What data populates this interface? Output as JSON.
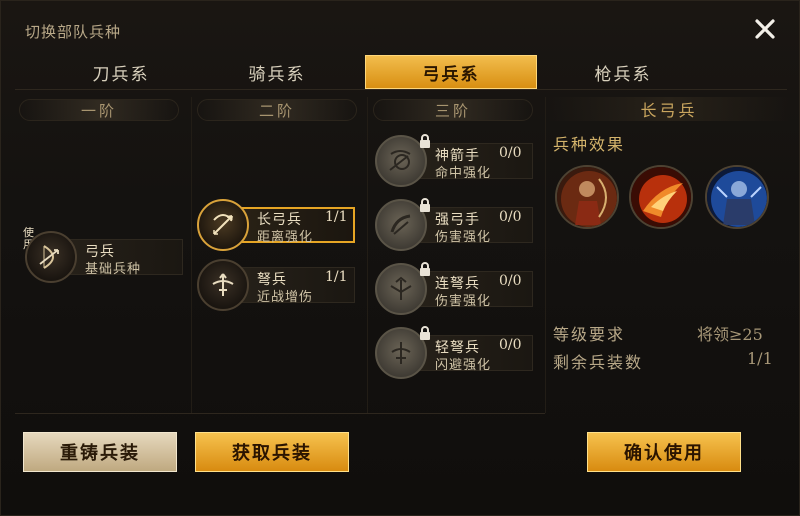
{
  "window": {
    "title": "切换部队兵种",
    "close_icon": "close-icon"
  },
  "tabs": [
    {
      "label": "刀兵系",
      "active": false
    },
    {
      "label": "骑兵系",
      "active": false
    },
    {
      "label": "弓兵系",
      "active": true
    },
    {
      "label": "枪兵系",
      "active": false
    }
  ],
  "tiers": [
    "一阶",
    "二阶",
    "三阶"
  ],
  "units": {
    "tier1": [
      {
        "name": "弓兵",
        "count": "",
        "desc": "基础兵种",
        "in_use": true,
        "use_label": "使用",
        "icon": "bow-icon"
      }
    ],
    "tier2": [
      {
        "name": "长弓兵",
        "count": "1/1",
        "desc": "距离强化",
        "selected": true,
        "icon": "longbow-icon"
      },
      {
        "name": "弩兵",
        "count": "1/1",
        "desc": "近战增伤",
        "icon": "crossbow-icon"
      }
    ],
    "tier3": [
      {
        "name": "神箭手",
        "count": "0/0",
        "desc": "命中强化",
        "locked": true,
        "icon": "target-bow-icon"
      },
      {
        "name": "强弓手",
        "count": "0/0",
        "desc": "伤害强化",
        "locked": true,
        "icon": "strong-bow-icon"
      },
      {
        "name": "连弩兵",
        "count": "0/0",
        "desc": "伤害强化",
        "locked": true,
        "icon": "repeating-crossbow-icon"
      },
      {
        "name": "轻弩兵",
        "count": "0/0",
        "desc": "闪避强化",
        "locked": true,
        "icon": "light-crossbow-icon"
      }
    ]
  },
  "detail": {
    "title": "长弓兵",
    "effects_label": "兵种效果",
    "effects": [
      "archer-portrait-icon",
      "fire-burst-icon",
      "armored-warrior-icon"
    ],
    "level_req_label": "等级要求",
    "level_req_value": "将领≥25",
    "remaining_label": "剩余兵装数",
    "remaining_value": "1/1"
  },
  "buttons": {
    "recast": "重铸兵装",
    "acquire": "获取兵装",
    "confirm": "确认使用"
  },
  "colors": {
    "accent_gold": "#e6a524",
    "button_gold": "#f2bd4d",
    "text_light": "#e8dcc0"
  }
}
